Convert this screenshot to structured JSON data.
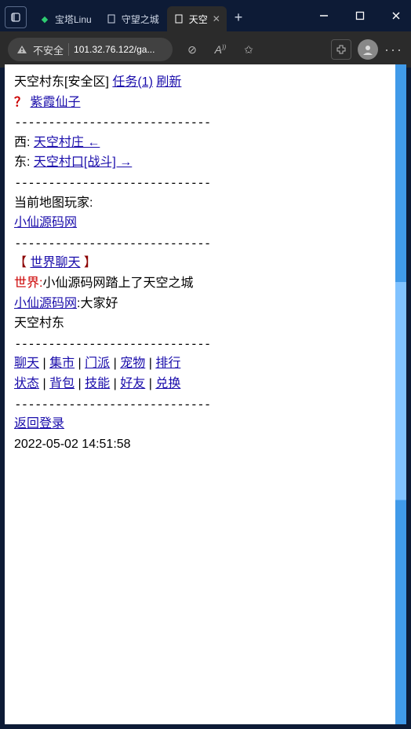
{
  "window": {
    "tabs": [
      {
        "favicon_name": "shield-green-icon",
        "label": "宝塔Linu",
        "active": false
      },
      {
        "favicon_name": "page-icon",
        "label": "守望之城",
        "active": false
      },
      {
        "favicon_name": "page-icon",
        "label": "天空",
        "active": true
      }
    ],
    "url_warning_label": "不安全",
    "url": "101.32.76.122/ga..."
  },
  "game": {
    "location": "天空村东[安全区]",
    "task_link": "任务(1)",
    "refresh_link": "刷新",
    "npc": "紫霞仙子",
    "divider": "-----------------------------",
    "dir_west_label": "西:",
    "dir_west_link": "天空村庄 ←",
    "dir_east_label": "东:",
    "dir_east_link": "天空村口[战斗] →",
    "players_header": "当前地图玩家:",
    "player_link": "小仙源码网",
    "chat_header_left": "【 ",
    "chat_header_link": "世界聊天",
    "chat_header_right": " 】",
    "world_prefix": "世界:",
    "world_msg": "小仙源码网踏上了天空之城",
    "chat_user_link": "小仙源码网",
    "chat_user_msg": ":大家好",
    "chat_echo": "天空村东",
    "menu1": [
      "聊天",
      "集市",
      "门派",
      "宠物",
      "排行"
    ],
    "menu2": [
      "状态",
      "背包",
      "技能",
      "好友",
      "兑换"
    ],
    "logout_link": "返回登录",
    "timestamp": "2022-05-02 14:51:58"
  }
}
